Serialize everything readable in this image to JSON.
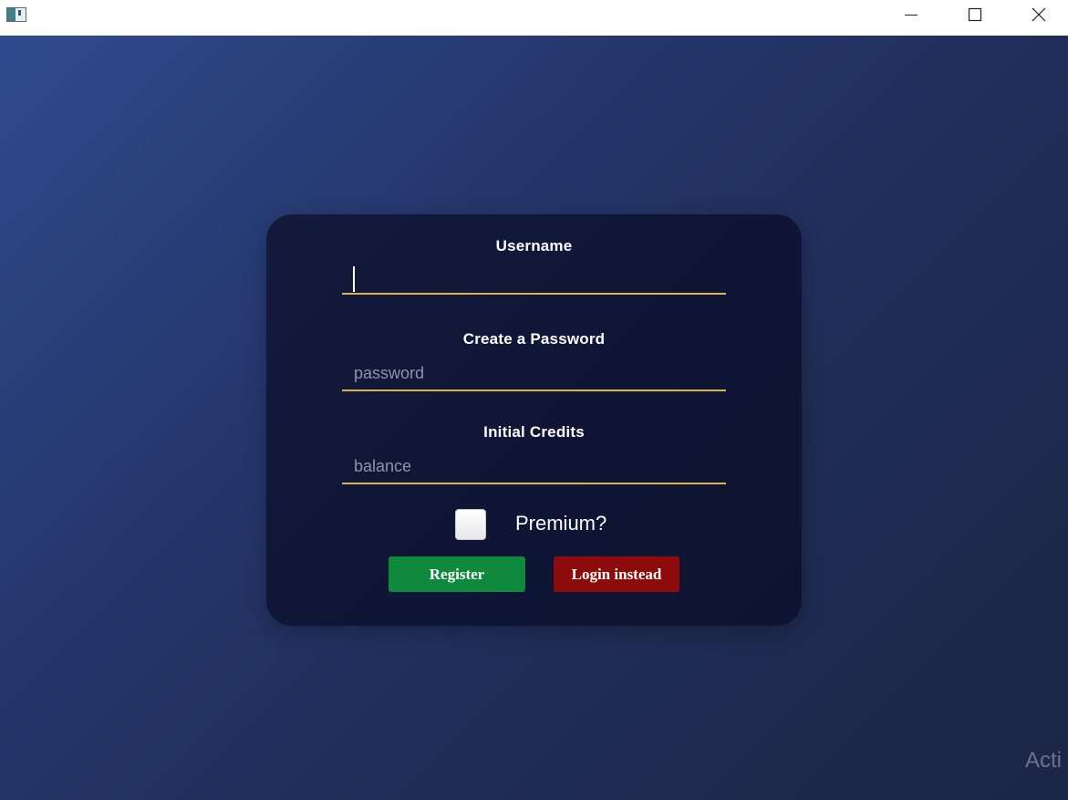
{
  "titlebar": {
    "icon": "app-window-icon",
    "controls": [
      "minimize-icon",
      "maximize-icon",
      "close-icon"
    ]
  },
  "form": {
    "username_label": "Username",
    "username_value": "",
    "password_label": "Create a Password",
    "password_placeholder": "password",
    "credits_label": "Initial Credits",
    "credits_placeholder": "balance",
    "premium_label": "Premium?",
    "premium_checked": false,
    "register_label": "Register",
    "login_label": "Login instead"
  },
  "watermark": {
    "text": "Acti"
  },
  "colors": {
    "accent_underline": "#d9b64a",
    "register": "#0f8a3d",
    "login": "#8e0b0b"
  }
}
